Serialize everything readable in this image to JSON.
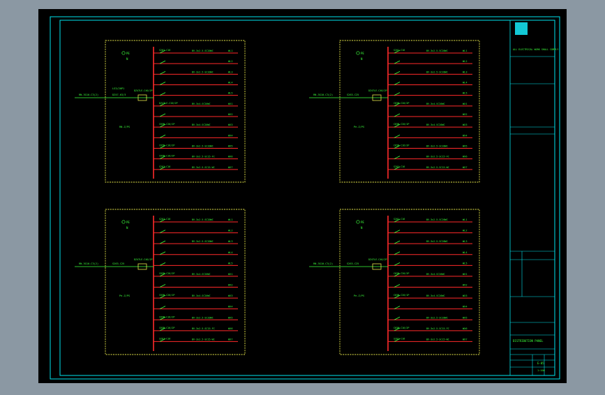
{
  "colors": {
    "background": "#8b98a3",
    "sheet": "#000000",
    "frame": "#00e5ee",
    "panel_border": "#e8e84a",
    "bus": "#ff2a2a",
    "text": "#3cff3c",
    "logo": "#13c9d6"
  },
  "panels": [
    {
      "pe_label": "PE",
      "n_label": "N",
      "side_a": "LS3/20P1",
      "side_b": "RN-Z/PS",
      "feeder": "RN-3G10-C3(2)",
      "main_switch": "DZ47-63/3",
      "meter": "DZ47LE-C40/2P",
      "circuits": [
        {
          "breaker": "S201-C16",
          "load": "BV-3x2.5-SC20WC",
          "id": "WL1"
        },
        {
          "breaker": "",
          "load": "",
          "id": "WL2"
        },
        {
          "breaker": "",
          "load": "BV-3x2.5-SC20WC",
          "id": "WL3"
        },
        {
          "breaker": "",
          "load": "",
          "id": "WL4"
        },
        {
          "breaker": "",
          "load": "",
          "id": "WL5"
        },
        {
          "breaker": "DZ47LE-C20/2P",
          "load": "BV-3x4-SC20WC",
          "id": "WX1"
        },
        {
          "breaker": "",
          "load": "",
          "id": "WX2"
        },
        {
          "breaker": "C65N-C20/1P",
          "load": "BV-3x4-SC20WC",
          "id": "WX3"
        },
        {
          "breaker": "",
          "load": "",
          "id": "WX4"
        },
        {
          "breaker": "C65N-C16/2P",
          "load": "BV-3x2.5-SC20WC",
          "id": "WX5"
        },
        {
          "breaker": "C65N-C16/2P",
          "load": "BV-3x2.5-SC15-FC",
          "id": "WX6"
        },
        {
          "breaker": "S201-C16",
          "load": "BV-3x2.5-SC15-WC",
          "id": "WX7"
        }
      ]
    },
    {
      "pe_label": "PE",
      "n_label": "N",
      "side_a": "",
      "side_b": "Pe-Z/PS",
      "feeder": "RN-3G10-C3(2)",
      "main_switch": "S263-C25",
      "meter": "DZ47LE-C40/2P",
      "circuits": [
        {
          "breaker": "S201-C16",
          "load": "BV-3x2.5-SC20WC",
          "id": "WL1"
        },
        {
          "breaker": "",
          "load": "",
          "id": "WL2"
        },
        {
          "breaker": "",
          "load": "BV-3x2.5-SC20WC",
          "id": "WL3"
        },
        {
          "breaker": "",
          "load": "",
          "id": "WL4"
        },
        {
          "breaker": "",
          "load": "",
          "id": "WL5"
        },
        {
          "breaker": "C65N-C20/2P",
          "load": "BV-3x4-SC20WC",
          "id": "WX1"
        },
        {
          "breaker": "",
          "load": "",
          "id": "WX2"
        },
        {
          "breaker": "C65N-C20/1P",
          "load": "BV-3x4-SC20WC",
          "id": "WX3"
        },
        {
          "breaker": "",
          "load": "",
          "id": "WX4"
        },
        {
          "breaker": "C65N-C16/2P",
          "load": "BV-3x2.5-SC20WC",
          "id": "WX5"
        },
        {
          "breaker": "",
          "load": "BV-3x2.5-SC15-FC",
          "id": "WX6"
        },
        {
          "breaker": "S201-C16",
          "load": "BV-3x2.5-SC15-WC",
          "id": "WX7"
        }
      ]
    },
    {
      "pe_label": "PE",
      "n_label": "N",
      "side_a": "",
      "side_b": "Pe-Z/PS",
      "feeder": "RN-3G10-C3(2)",
      "main_switch": "S263-C25",
      "meter": "DZ47LE-C40/2P",
      "circuits": [
        {
          "breaker": "S201-C16",
          "load": "BV-3x2.5-SC20WC",
          "id": "WL1"
        },
        {
          "breaker": "",
          "load": "",
          "id": "WL2"
        },
        {
          "breaker": "",
          "load": "BV-3x2.5-SC20WC",
          "id": "WL3"
        },
        {
          "breaker": "",
          "load": "",
          "id": "WL4"
        },
        {
          "breaker": "",
          "load": "",
          "id": "WL5"
        },
        {
          "breaker": "C65N-C20/2P",
          "load": "BV-3x4-SC20WC",
          "id": "WX1"
        },
        {
          "breaker": "",
          "load": "",
          "id": "WX2"
        },
        {
          "breaker": "C65N-C20/1P",
          "load": "BV-3x4-SC20WC",
          "id": "WX3"
        },
        {
          "breaker": "",
          "load": "",
          "id": "WX4"
        },
        {
          "breaker": "C65N-C16/2P",
          "load": "BV-3x2.5-SC20WC",
          "id": "WX5"
        },
        {
          "breaker": "C65N-C16/2P",
          "load": "BV-3x2.5-SC15-FC",
          "id": "WX6"
        },
        {
          "breaker": "S201-C16",
          "load": "BV-3x2.5-SC15-WC",
          "id": "WX7"
        }
      ]
    },
    {
      "pe_label": "PE",
      "n_label": "N",
      "side_a": "",
      "side_b": "Pe-Z/PS",
      "feeder": "RN-3G10-C3(2)",
      "main_switch": "S263-C25",
      "meter": "DZ47LE-C40/2P",
      "circuits": [
        {
          "breaker": "S201-C16",
          "load": "BV-3x2.5-SC20WC",
          "id": "WL1"
        },
        {
          "breaker": "",
          "load": "",
          "id": "WL2"
        },
        {
          "breaker": "",
          "load": "BV-3x2.5-SC20WC",
          "id": "WL3"
        },
        {
          "breaker": "",
          "load": "",
          "id": "WL4"
        },
        {
          "breaker": "",
          "load": "",
          "id": "WL5"
        },
        {
          "breaker": "C65N-C20/2P",
          "load": "BV-3x4-SC20WC",
          "id": "WX1"
        },
        {
          "breaker": "",
          "load": "",
          "id": "WX2"
        },
        {
          "breaker": "C65N-C20/1P",
          "load": "BV-3x4-SC20WC",
          "id": "WX3"
        },
        {
          "breaker": "",
          "load": "",
          "id": "WX4"
        },
        {
          "breaker": "",
          "load": "BV-3x2.5-SC20WC",
          "id": "WX5"
        },
        {
          "breaker": "C65N-C16/2P",
          "load": "BV-3x2.5-SC15-FC",
          "id": "WX6"
        },
        {
          "breaker": "S201-C16",
          "load": "BV-3x2.5-SC15-WC",
          "id": "WX7"
        }
      ]
    }
  ],
  "title_block": {
    "design_note": "ALL ELECTRICAL WORK SHALL COMPLY",
    "drawing_title": "DISTRIBUTION PANEL",
    "drawing_no": "E-05",
    "scale": "1:100"
  }
}
